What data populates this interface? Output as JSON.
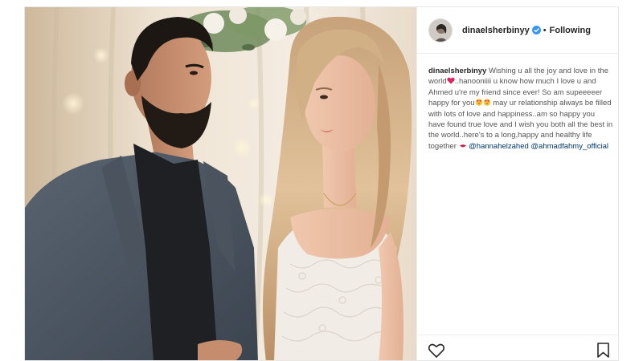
{
  "post": {
    "username": "dinaelsherbinyy",
    "separator": "•",
    "follow_status": "Following",
    "caption": {
      "username": "dinaelsherbinyy",
      "part1": "Wishing u all the joy and love in the world",
      "part2": "..hanooniiii u know how much I love u and Ahmed u're my friend since ever! So am supeeeeer happy for you",
      "part3": " may ur relationship always be filled with lots of love and happiness..am so happy you have found true love and I wish you both all the best in the world..here's to a long,happy and healthy life together ",
      "mention1": "@hannahelzahed",
      "mention2": "@ahmadfahmy_official"
    },
    "emoji_icons": [
      "heart-emoji",
      "heart-eyes-emoji",
      "kiss-emoji"
    ]
  },
  "icons": {
    "verified": "verified-badge-icon",
    "like": "heart-icon",
    "save": "bookmark-icon"
  },
  "colors": {
    "verified_badge": "#3897f0",
    "mention_link": "#003569",
    "text": "#262626"
  }
}
